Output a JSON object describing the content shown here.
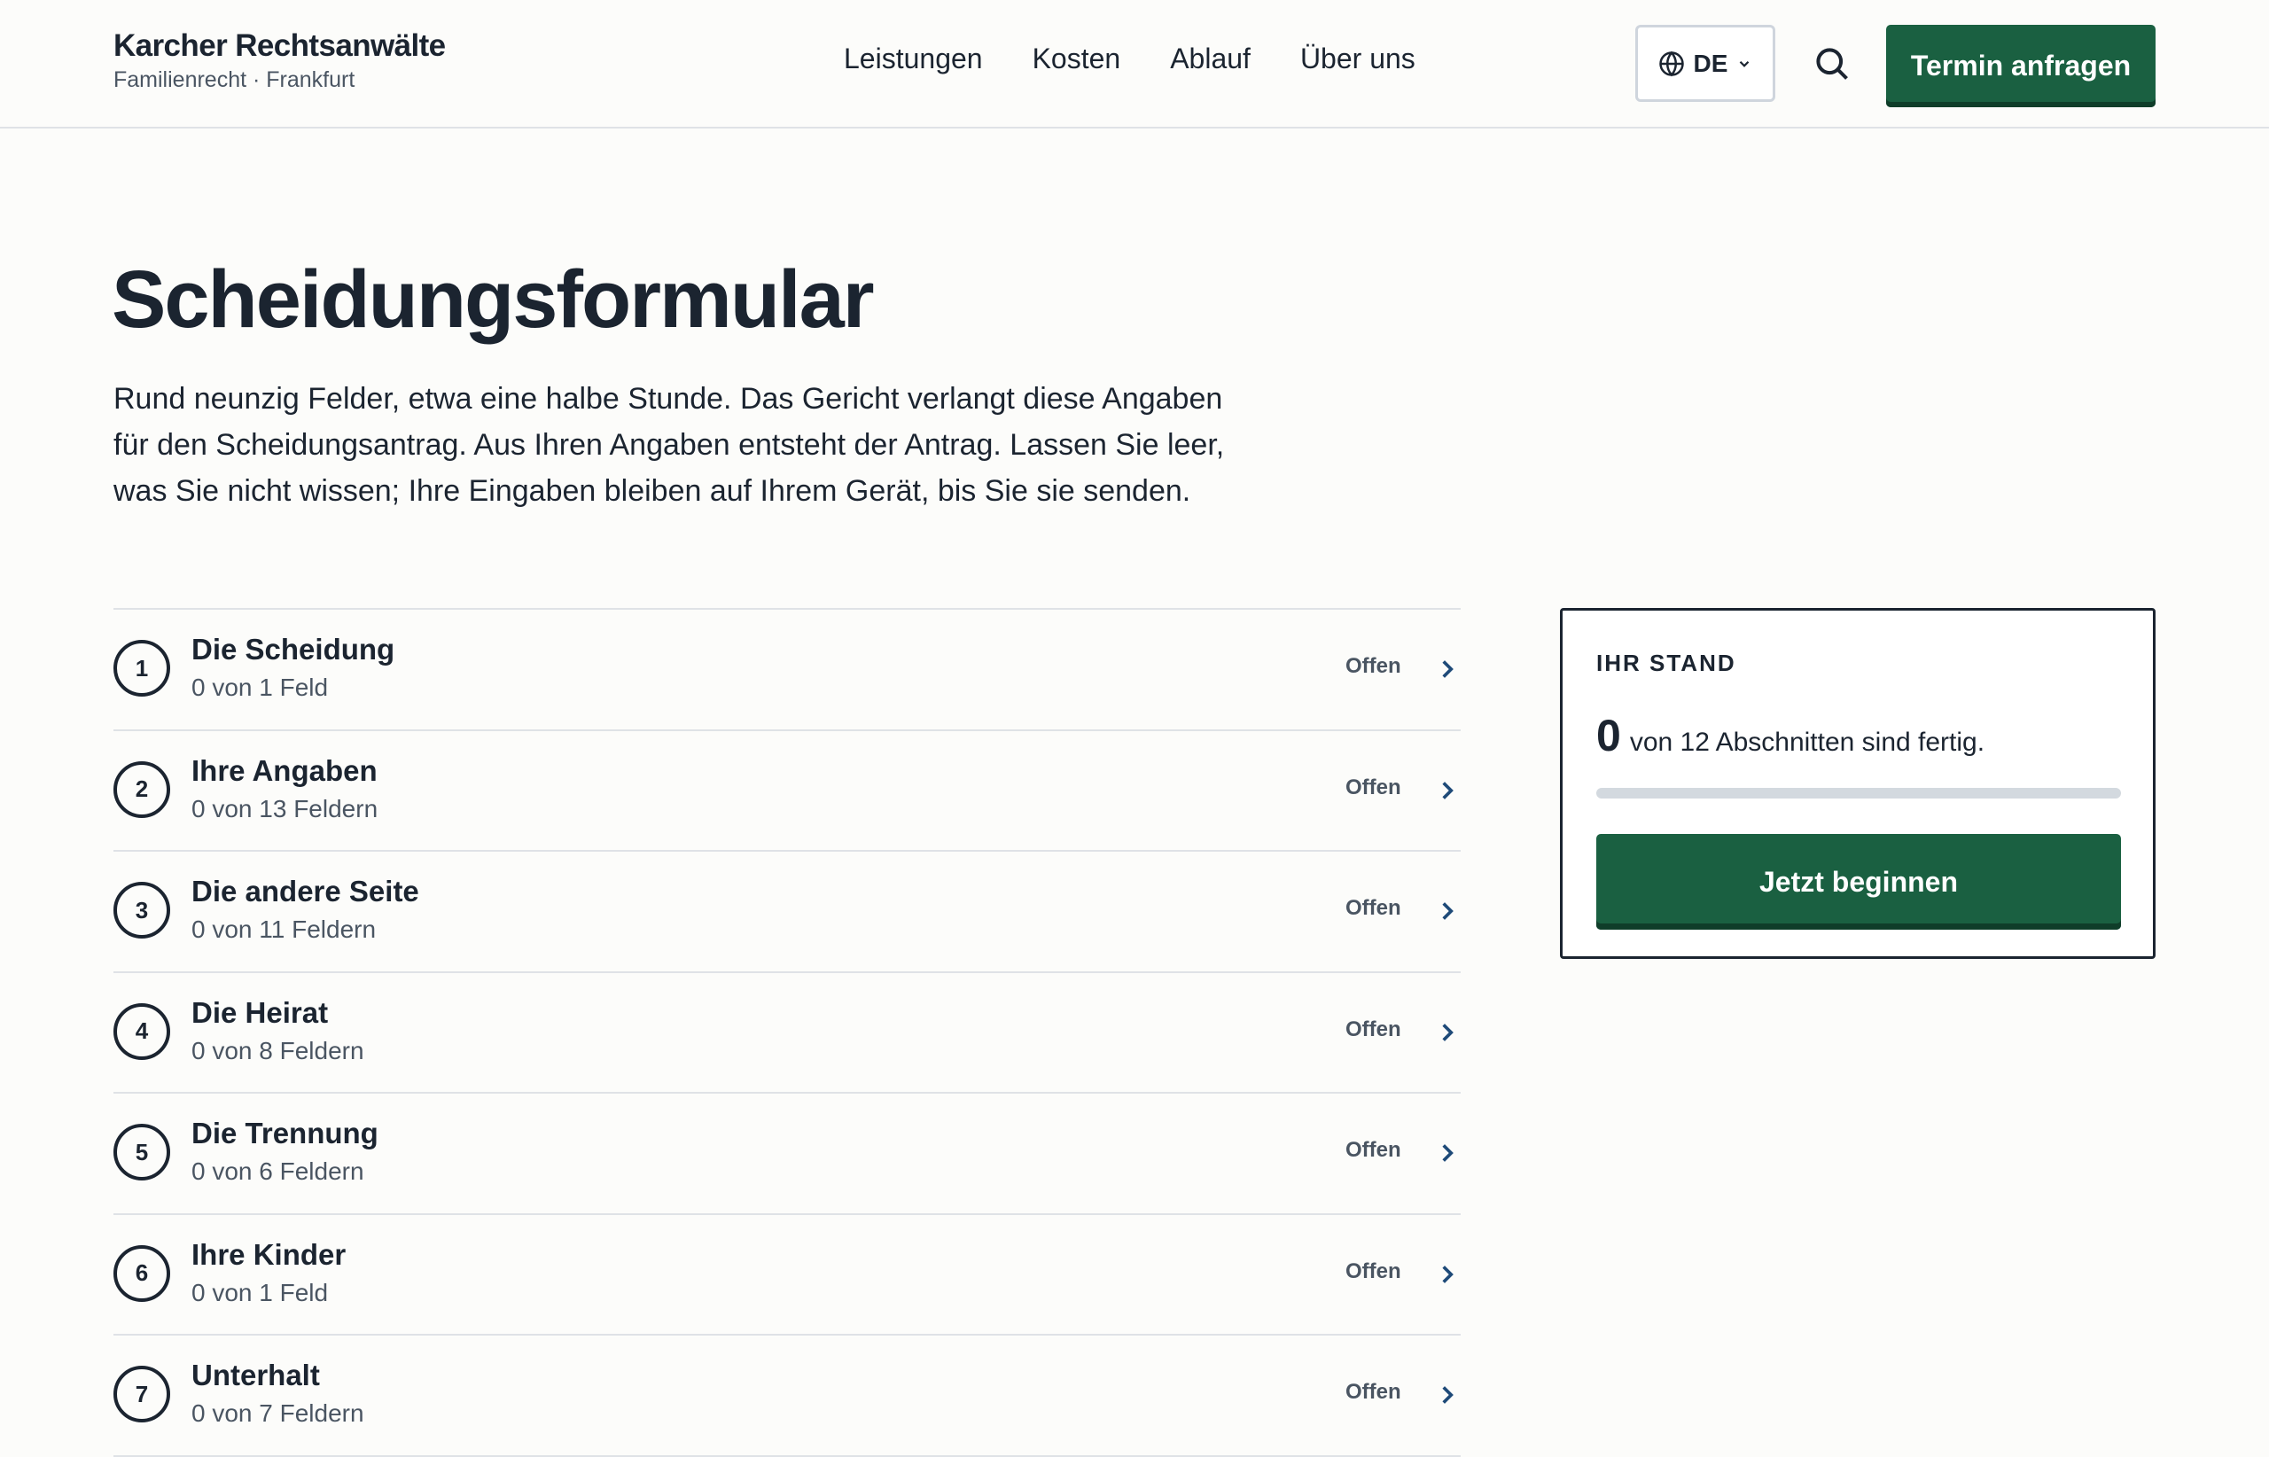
{
  "header": {
    "brand_name": "Karcher Rechtsanwälte",
    "brand_sub": "Familienrecht · Frankfurt",
    "nav": [
      "Leistungen",
      "Kosten",
      "Ablauf",
      "Über uns"
    ],
    "language": "DE",
    "cta_label": "Termin anfragen"
  },
  "main": {
    "title": "Scheidungsformular",
    "intro": "Rund neunzig Felder, etwa eine halbe Stunde. Das Gericht verlangt diese Angaben für den Scheidungsantrag. Aus Ihren Angaben entsteht der Antrag. Lassen Sie leer, was Sie nicht wissen; Ihre Eingaben bleiben auf Ihrem Gerät, bis Sie sie senden.",
    "sections": [
      {
        "num": "1",
        "title": "Die Scheidung",
        "sub": "0 von 1 Feld",
        "status": "Offen"
      },
      {
        "num": "2",
        "title": "Ihre Angaben",
        "sub": "0 von 13 Feldern",
        "status": "Offen"
      },
      {
        "num": "3",
        "title": "Die andere Seite",
        "sub": "0 von 11 Feldern",
        "status": "Offen"
      },
      {
        "num": "4",
        "title": "Die Heirat",
        "sub": "0 von 8 Feldern",
        "status": "Offen"
      },
      {
        "num": "5",
        "title": "Die Trennung",
        "sub": "0 von 6 Feldern",
        "status": "Offen"
      },
      {
        "num": "6",
        "title": "Ihre Kinder",
        "sub": "0 von 1 Feld",
        "status": "Offen"
      },
      {
        "num": "7",
        "title": "Unterhalt",
        "sub": "0 von 7 Feldern",
        "status": "Offen"
      }
    ]
  },
  "progress_card": {
    "label": "IHR STAND",
    "count": "0",
    "text": "von 12 Abschnitten sind fertig.",
    "progress_fraction": 0,
    "button_label": "Jetzt beginnen"
  },
  "colors": {
    "accent": "#1a6041",
    "text": "#1b2430",
    "muted": "#4a5562",
    "divider": "#dfe2e6",
    "background": "#fcfcfa"
  },
  "icons": {
    "language": "globe-icon",
    "dropdown": "chevron-down-icon",
    "search": "search-icon",
    "row_arrow": "chevron-right-icon"
  }
}
